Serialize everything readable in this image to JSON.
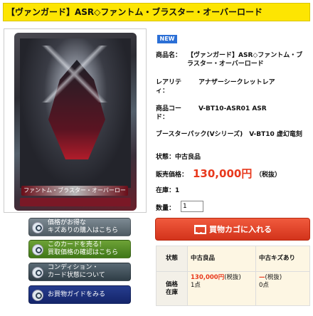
{
  "header": {
    "title": "【ヴァンガード】ASR◇ファントム・ブラスター・オーバーロード"
  },
  "card_image": {
    "name_bar": "ファントム・ブラスター・オーバーロード"
  },
  "side_buttons": [
    {
      "line1": "価格がお得な",
      "line2": "キズありの購入はこちら"
    },
    {
      "line1": "このカードを売る！",
      "line2": "買取価格の確認はこちら"
    },
    {
      "line1": "コンディション・",
      "line2": "カード状態について"
    },
    {
      "line1": "お買物ガイドをみる",
      "line2": ""
    }
  ],
  "badge": "NEW",
  "product": {
    "name_label": "商品名：",
    "name_value": "【ヴァンガード】ASR◇ファントム・ブラスター・オーバーロード",
    "rarity_label": "レアリティ：",
    "rarity_value": "アナザーシークレットレア",
    "code_label": "商品コード：",
    "code_value": "V-BT10-ASR01 ASR",
    "pack": "ブースターパック(Vシリーズ)　V-BT10 虚幻竜刻",
    "state": "状態：中古良品",
    "price_label": "販売価格：",
    "price_value": "130,000円",
    "price_tax": "（税抜）",
    "stock": "在庫：1",
    "qty_label": "数量：",
    "qty_value": "1"
  },
  "cart_button": "買物カゴに入れる",
  "stock_table": {
    "head": [
      "状態",
      "中古良品",
      "中古キズあり"
    ],
    "row_label": "価格\n在庫",
    "good_price": "130,000円",
    "good_tax": "(税抜)",
    "good_stock": "1点",
    "scratch_price": "—",
    "scratch_tax": "(税抜)",
    "scratch_stock": "0点"
  }
}
